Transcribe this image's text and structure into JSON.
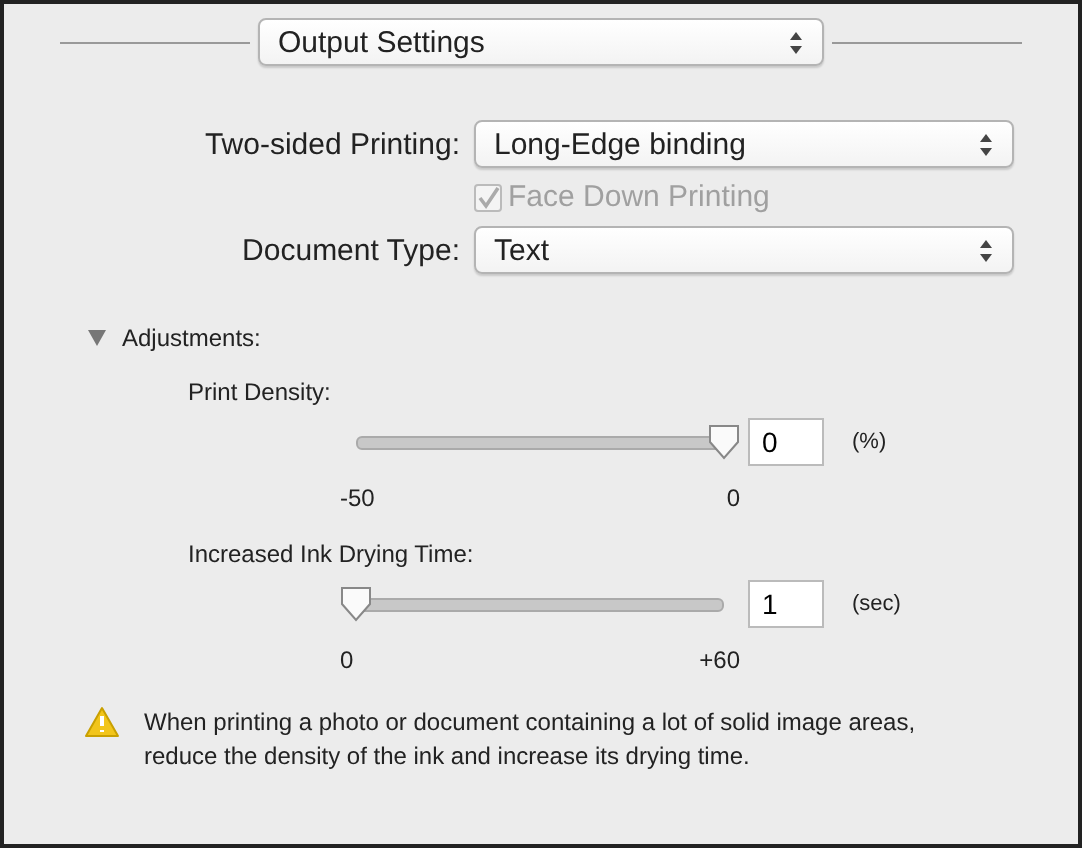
{
  "section_popup": {
    "value": "Output Settings"
  },
  "fields": [
    {
      "kind": "popup",
      "label": "Two-sided Printing:",
      "value": "Long-Edge binding"
    },
    {
      "kind": "checkbox",
      "label": "Face Down Printing",
      "checked": true,
      "disabled": true
    },
    {
      "kind": "popup",
      "label": "Document Type:",
      "value": "Text"
    }
  ],
  "adjustments": {
    "label": "Adjustments:",
    "expanded": true,
    "sliders": [
      {
        "label": "Print Density:",
        "level": 1,
        "value": "0",
        "unit": "(%)",
        "min_label": "-50",
        "max_label": "0"
      },
      {
        "label": "Increased Ink Drying Time:",
        "level": 0,
        "value": "1",
        "unit": "(sec)",
        "min_label": "0",
        "max_label": "+60"
      }
    ]
  },
  "warning": "When printing a photo or document containing a lot of solid image areas, reduce the density of the ink and increase its drying time."
}
